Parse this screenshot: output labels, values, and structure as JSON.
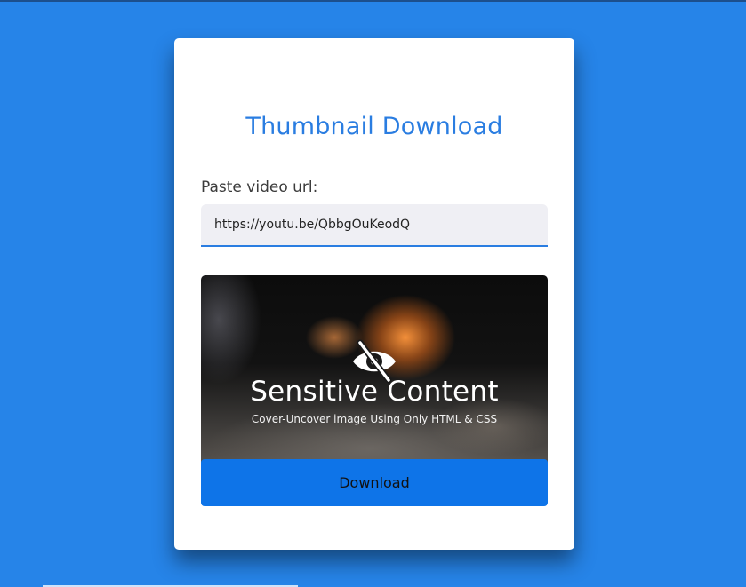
{
  "page": {
    "background_color": "#2684e8",
    "accent_color": "#2a7de1",
    "button_color": "#0e74e8"
  },
  "card": {
    "title": "Thumbnail Download",
    "url_label": "Paste video url:",
    "url_value": "https://youtu.be/QbbgOuKeodQ",
    "thumbnail": {
      "icon": "eye-slash-icon",
      "headline": "Sensitive Content",
      "subline": "Cover-Uncover image Using Only HTML & CSS"
    },
    "download_label": "Download"
  }
}
